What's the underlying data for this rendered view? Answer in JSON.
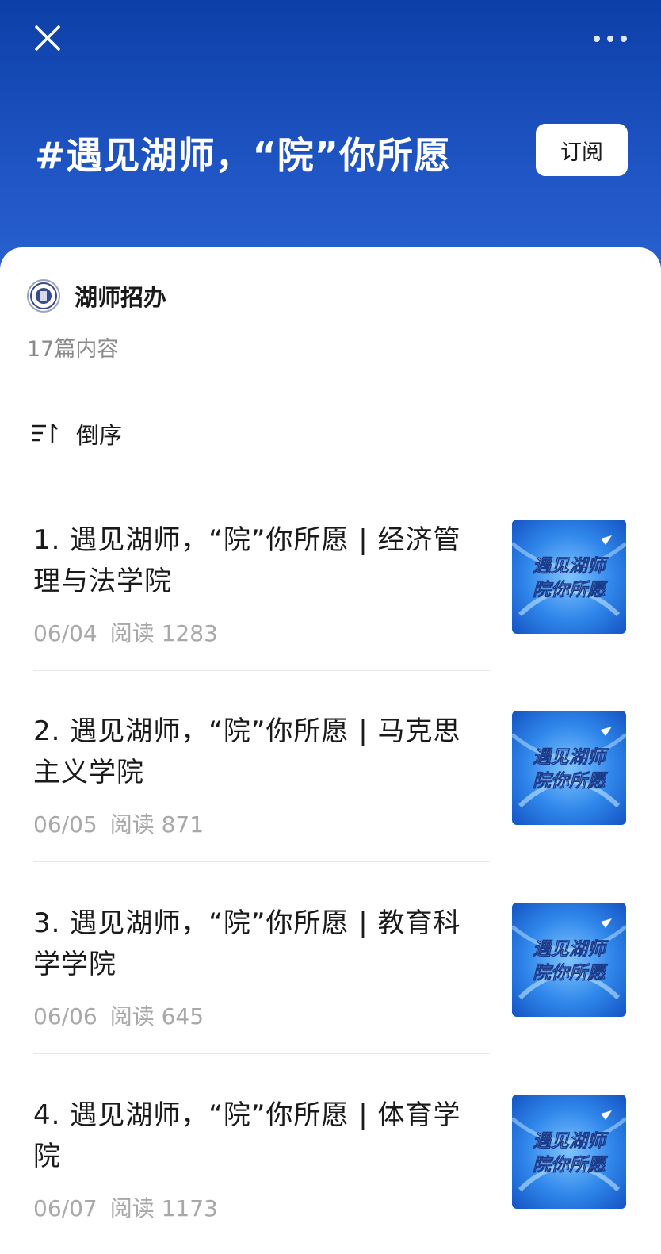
{
  "header": {
    "topic_title": "#遇见湖师，“院”你所愿",
    "subscribe_label": "订阅"
  },
  "author": {
    "name": "湖师招办"
  },
  "summary": {
    "count_text": "17篇内容"
  },
  "sort": {
    "label": "倒序"
  },
  "articles": [
    {
      "title": "1. 遇见湖师，“院”你所愿 | 经济管理与法学院",
      "date": "06/04",
      "reads": "阅读 1283",
      "thumb_text_line1": "遇见湖师",
      "thumb_text_line2": "院你所愿"
    },
    {
      "title": "2. 遇见湖师，“院”你所愿 | 马克思主义学院",
      "date": "06/05",
      "reads": "阅读 871",
      "thumb_text_line1": "遇见湖师",
      "thumb_text_line2": "院你所愿"
    },
    {
      "title": "3. 遇见湖师，“院”你所愿 | 教育科学学院",
      "date": "06/06",
      "reads": "阅读 645",
      "thumb_text_line1": "遇见湖师",
      "thumb_text_line2": "院你所愿"
    },
    {
      "title": "4. 遇见湖师，“院”你所愿 | 体育学院",
      "date": "06/07",
      "reads": "阅读 1173",
      "thumb_text_line1": "遇见湖师",
      "thumb_text_line2": "院你所愿"
    }
  ],
  "colors": {
    "header_blue": "#1f55c4",
    "meta_gray": "#a8a8a8"
  },
  "icons": {
    "close": "close-icon",
    "more": "more-icon",
    "sort": "sort-icon"
  }
}
